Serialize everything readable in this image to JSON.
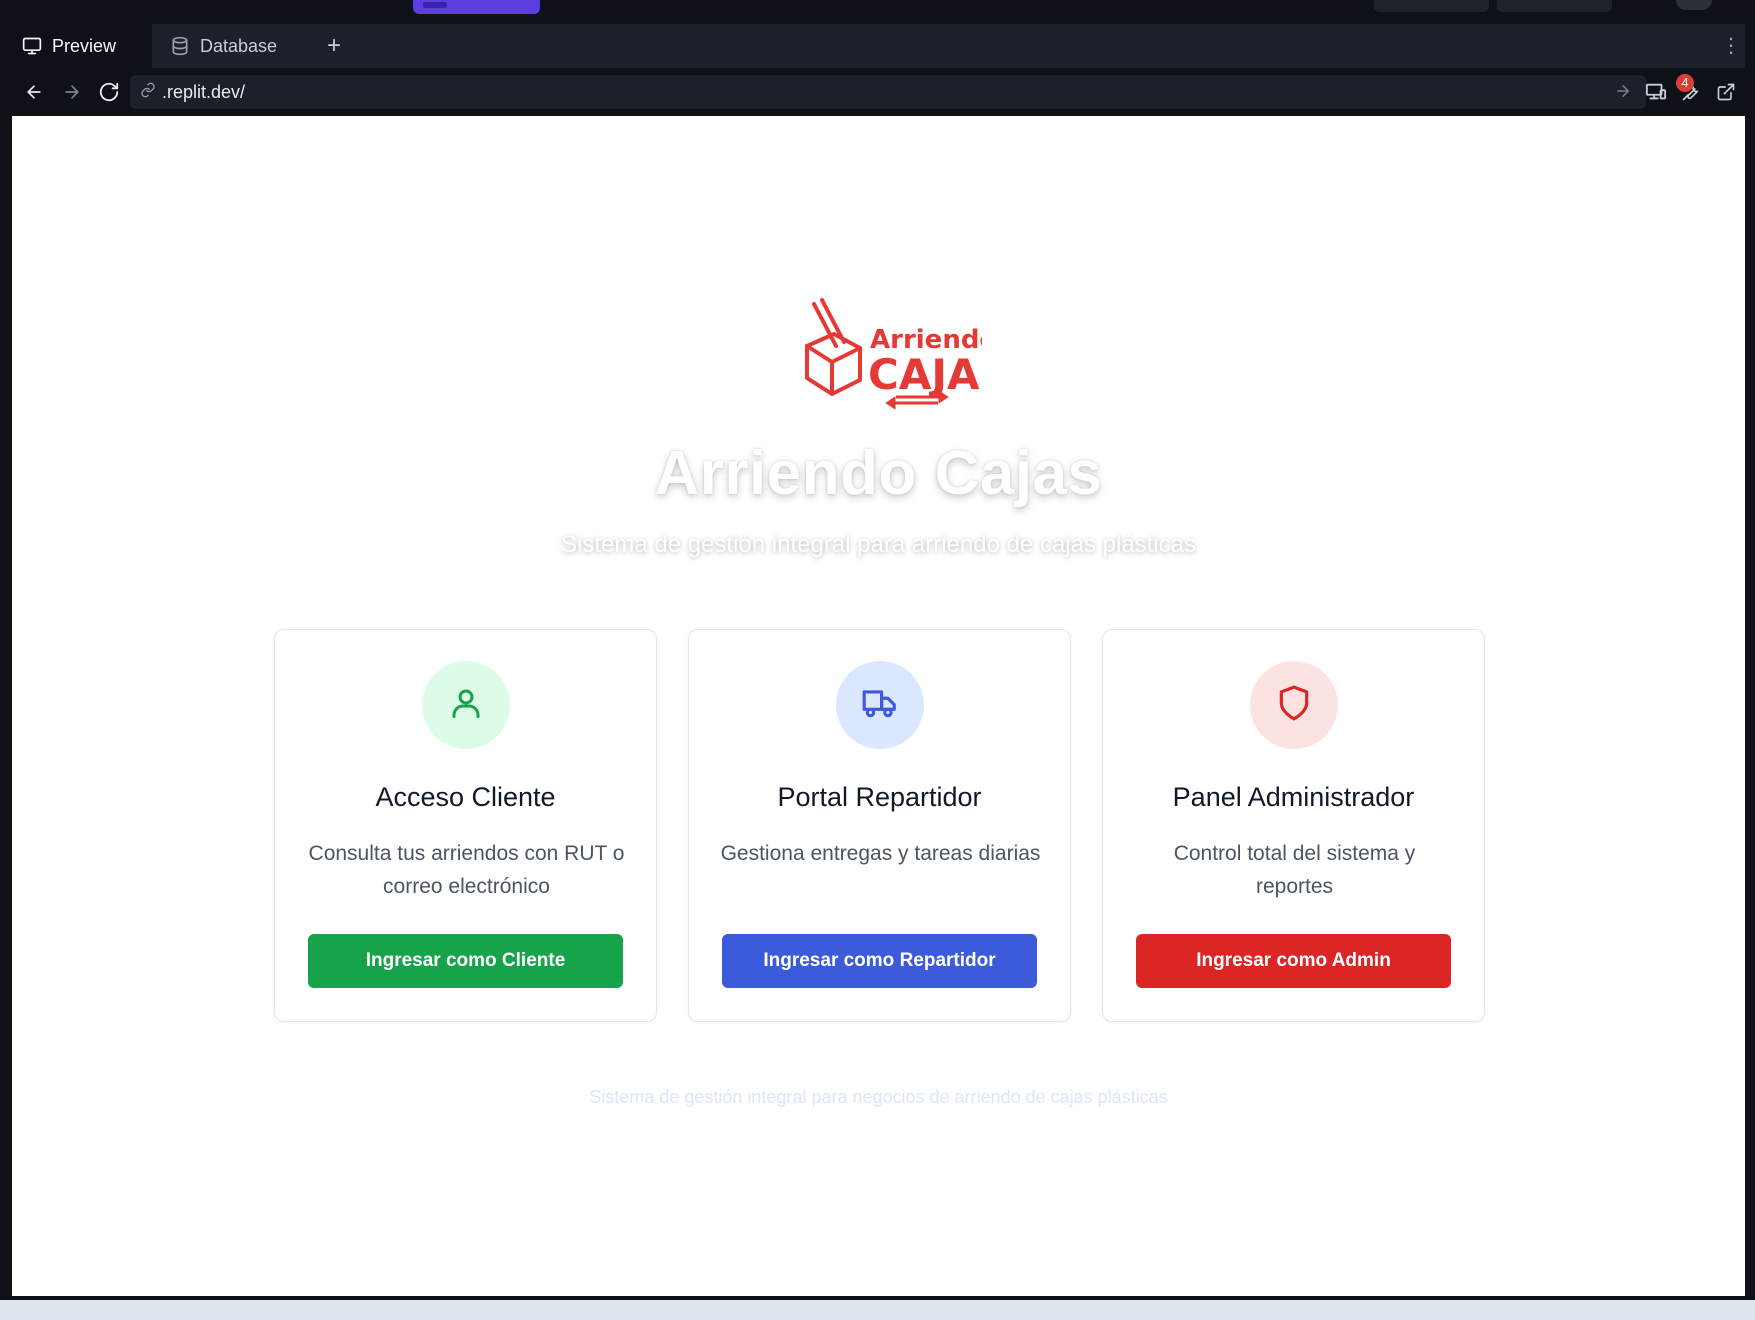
{
  "browser": {
    "tabs": [
      {
        "label": "Preview",
        "icon": "monitor-icon",
        "active": true
      },
      {
        "label": "Database",
        "icon": "database-icon",
        "active": false
      }
    ],
    "new_tab_label": "+",
    "url": ".replit.dev/",
    "notification_count": "4"
  },
  "page": {
    "logo": {
      "line1": "Arriendo",
      "line2": "CAJAS",
      "color": "#e53935"
    },
    "title": "Arriendo Cajas",
    "subtitle": "Sistema de gestión integral para arriendo de cajas plásticas",
    "cards": [
      {
        "icon": "user-icon",
        "title": "Acceso Cliente",
        "description": "Consulta tus arriendos con RUT o correo electrónico",
        "button": "Ingresar como Cliente",
        "accent": "#16a34a",
        "circle_bg": "#dcfce7"
      },
      {
        "icon": "truck-icon",
        "title": "Portal Repartidor",
        "description": "Gestiona entregas y tareas diarias",
        "button": "Ingresar como Repartidor",
        "accent": "#3b5bdb",
        "circle_bg": "#dbe7fe"
      },
      {
        "icon": "shield-icon",
        "title": "Panel Administrador",
        "description": "Control total del sistema y reportes",
        "button": "Ingresar como Admin",
        "accent": "#dc2626",
        "circle_bg": "#fde2e2"
      }
    ],
    "footer": "Sistema de gestión integral para negocios de arriendo de cajas plásticas"
  }
}
